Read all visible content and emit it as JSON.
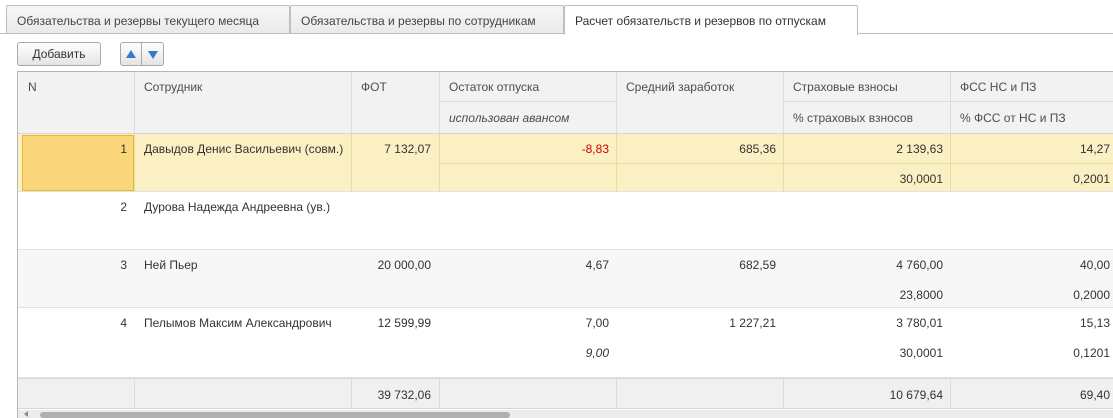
{
  "tabs": [
    {
      "label": "Обязательства и резервы текущего месяца",
      "active": false
    },
    {
      "label": "Обязательства и резервы по сотрудникам",
      "active": false
    },
    {
      "label": "Расчет обязательств и резервов по отпускам",
      "active": true
    }
  ],
  "toolbar": {
    "add_label": "Добавить",
    "move_up_icon": "arrow-up-icon",
    "move_down_icon": "arrow-down-icon"
  },
  "table": {
    "headers": {
      "n": "N",
      "employee": "Сотрудник",
      "fot": "ФОТ",
      "vacation_balance": "Остаток отпуска",
      "vacation_balance_sub": "использован авансом",
      "avg_earnings": "Средний заработок",
      "insurance": "Страховые взносы",
      "insurance_sub": "% страховых взносов",
      "fss": "ФСС НС и ПЗ",
      "fss_sub": "% ФСС от НС и ПЗ"
    },
    "rows": [
      {
        "n": "1",
        "employee": "Давыдов Денис Васильевич (совм.)",
        "fot": "7 132,07",
        "balance": "-8,83",
        "balance_sub": "",
        "avg": "685,36",
        "insurance": "2 139,63",
        "insurance_pct": "30,0001",
        "fss": "14,27",
        "fss_pct": "0,2001"
      },
      {
        "n": "2",
        "employee": "Дурова Надежда Андреевна (ув.)",
        "fot": "",
        "balance": "",
        "balance_sub": "",
        "avg": "",
        "insurance": "",
        "insurance_pct": "",
        "fss": "",
        "fss_pct": ""
      },
      {
        "n": "3",
        "employee": "Ней Пьер",
        "fot": "20 000,00",
        "balance": "4,67",
        "balance_sub": "",
        "avg": "682,59",
        "insurance": "4 760,00",
        "insurance_pct": "23,8000",
        "fss": "40,00",
        "fss_pct": "0,2000"
      },
      {
        "n": "4",
        "employee": "Пелымов Максим Александрович",
        "fot": "12 599,99",
        "balance": "7,00",
        "balance_sub": "9,00",
        "avg": "1 227,21",
        "insurance": "3 780,01",
        "insurance_pct": "30,0001",
        "fss": "15,13",
        "fss_pct": "0,1201"
      }
    ],
    "totals": {
      "fot": "39 732,06",
      "insurance": "10 679,64",
      "fss": "69,40"
    }
  },
  "colors": {
    "selected_row": "#fbf0c4",
    "selected_cell": "#f9d77a",
    "negative": "#d40000",
    "accent": "#3a78c8"
  }
}
